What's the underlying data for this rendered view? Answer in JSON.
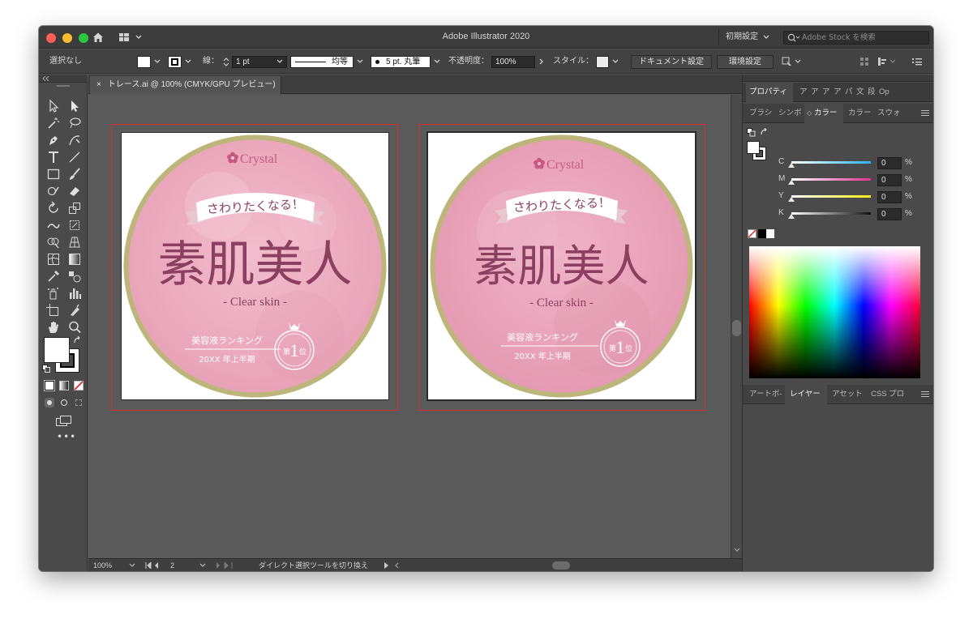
{
  "window": {
    "title": "Adobe Illustrator 2020",
    "workspace_preset": "初期設定",
    "stock_search_placeholder": "Adobe Stock を検索"
  },
  "control_bar": {
    "selection": "選択なし",
    "stroke_label": "線：",
    "stroke_weight": "1 pt",
    "stroke_profile": "均等",
    "brush": "5 pt. 丸筆",
    "opacity_label": "不透明度：",
    "opacity_value": "100%",
    "style_label": "スタイル：",
    "doc_setup_button": "ドキュメント設定",
    "prefs_button": "環境設定"
  },
  "document": {
    "tab_title": "トレース.ai @ 100% (CMYK/GPU プレビュー)"
  },
  "artwork": {
    "brand": "Crystal",
    "ribbon": "さわりたくなる！",
    "headline": "素肌美人",
    "subline": "- Clear skin -",
    "ranking": "美容液ランキング",
    "period": "20XX 年上半期",
    "medal_prefix": "第",
    "medal_number": "1",
    "medal_suffix": "位"
  },
  "status_bar": {
    "zoom": "100%",
    "artboard_number": "2",
    "tool_hint": "ダイレクト選択ツールを切り換え"
  },
  "right_panel": {
    "top_tabs": [
      "プロパティ",
      "ア",
      "ア",
      "ア",
      "ア",
      "パ",
      "文",
      "段",
      "Op"
    ],
    "color_tabs": [
      "ブラシ",
      "シンボ",
      "カラー",
      "カラー",
      "スウォ"
    ],
    "color_mode": "CMYK",
    "channels": [
      {
        "label": "C",
        "value": "0",
        "unit": "%",
        "color": "#29b5e8"
      },
      {
        "label": "M",
        "value": "0",
        "unit": "%",
        "color": "#e0318f"
      },
      {
        "label": "Y",
        "value": "0",
        "unit": "%",
        "color": "#f6eb14"
      },
      {
        "label": "K",
        "value": "0",
        "unit": "%",
        "color": "#111111"
      }
    ],
    "bottom_tabs": [
      "アートボ-",
      "レイヤー",
      "アセット",
      "CSS プロ"
    ]
  },
  "colors": {
    "badge_pink": "#ecaabe",
    "ring_olive": "#bcb67a",
    "text_plum": "#8c4060",
    "artboard_frame": "#d2302c"
  }
}
